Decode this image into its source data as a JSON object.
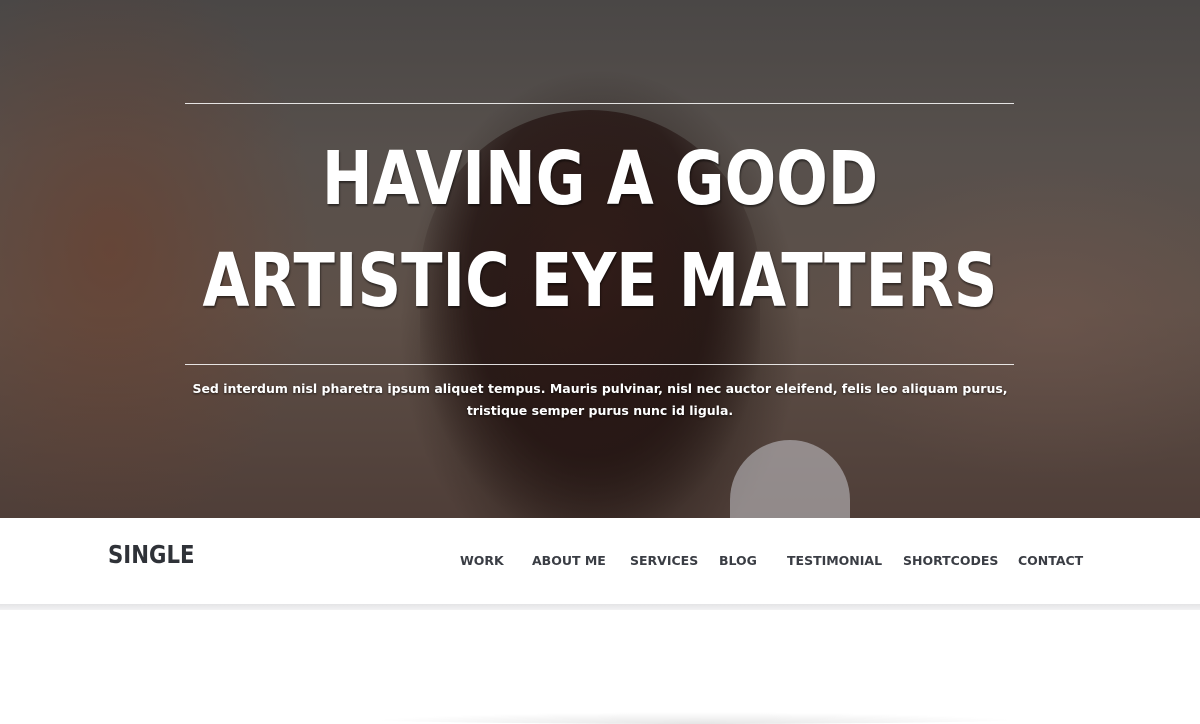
{
  "hero": {
    "title_line1": "HAVING A GOOD",
    "title_line2": "ARTISTIC EYE MATTERS",
    "subtitle": "Sed interdum nisl pharetra ipsum aliquet tempus. Mauris pulvinar, nisl nec auctor eleifend, felis leo aliquam purus, tristique semper purus nunc id ligula."
  },
  "navbar": {
    "logo": "SINGLE",
    "items": [
      {
        "label": "WORK"
      },
      {
        "label": "ABOUT ME"
      },
      {
        "label": "SERVICES"
      },
      {
        "label": "BLOG"
      },
      {
        "label": "TESTIMONIAL"
      },
      {
        "label": "SHORTCODES"
      },
      {
        "label": "CONTACT"
      }
    ]
  },
  "colors": {
    "nav_text": "#3a3d44",
    "logo_text": "#2f3238",
    "hero_text": "#ffffff"
  }
}
